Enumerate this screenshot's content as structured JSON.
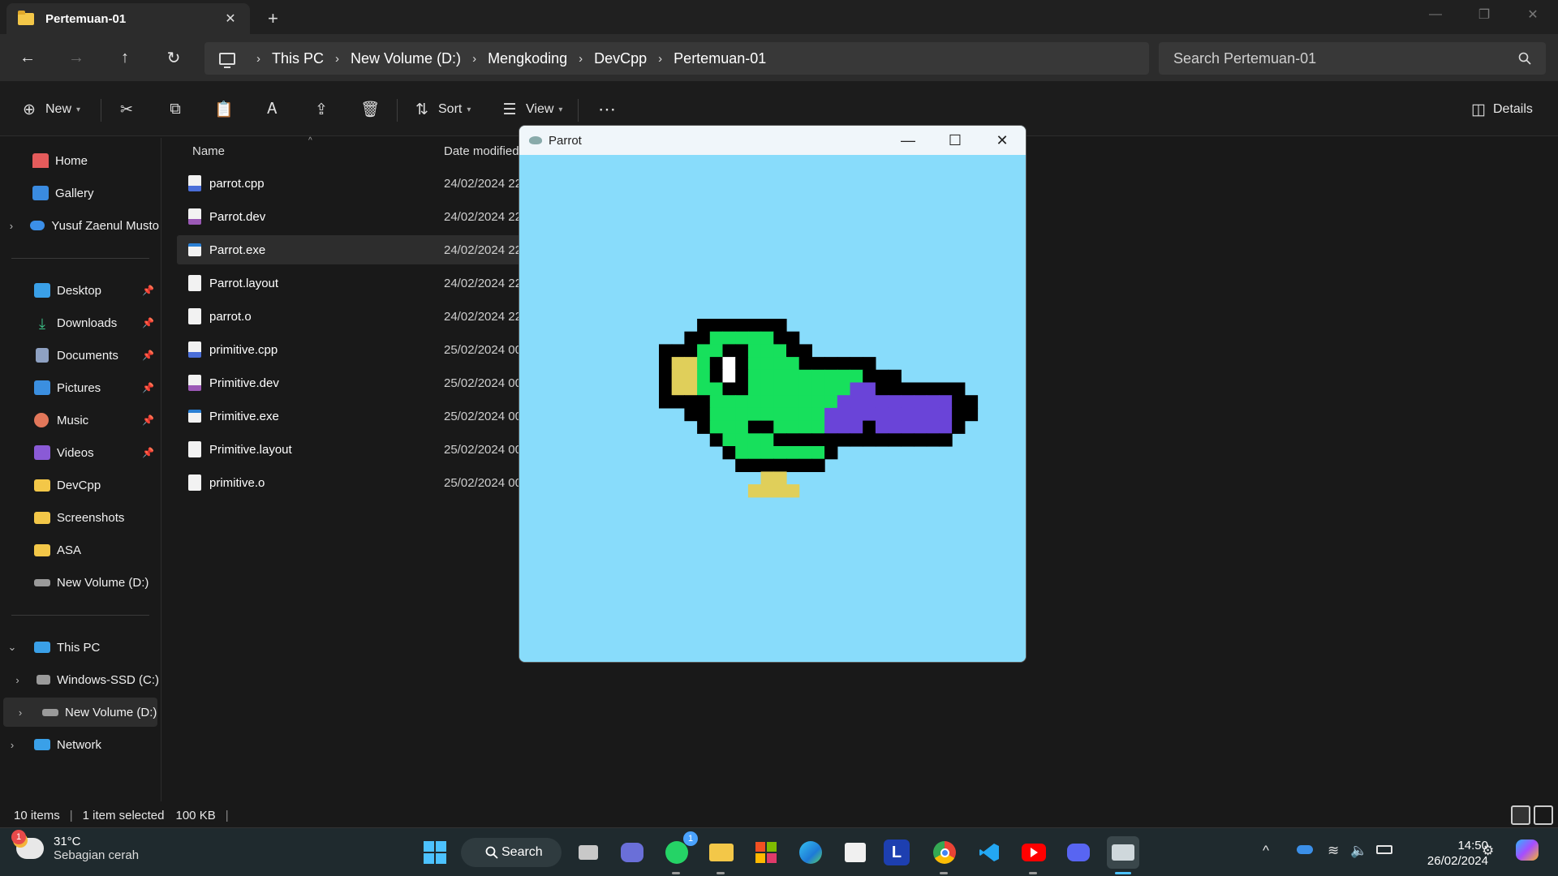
{
  "explorer": {
    "tab_title": "Pertemuan-01",
    "new_tab_glyph": "+",
    "breadcrumb": [
      "This PC",
      "New Volume (D:)",
      "Mengkoding",
      "DevCpp",
      "Pertemuan-01"
    ],
    "search_placeholder": "Search Pertemuan-01",
    "commands": {
      "new": "New",
      "sort": "Sort",
      "view": "View",
      "details": "Details"
    },
    "sidebar": {
      "home": "Home",
      "gallery": "Gallery",
      "onedrive": "Yusuf Zaenul Musto",
      "quick": [
        "Desktop",
        "Downloads",
        "Documents",
        "Pictures",
        "Music",
        "Videos",
        "DevCpp",
        "Screenshots",
        "ASA",
        "New Volume (D:)"
      ],
      "this_pc": "This PC",
      "drives": [
        "Windows-SSD (C:)",
        "New Volume (D:)"
      ],
      "network": "Network"
    },
    "columns": {
      "name": "Name",
      "date": "Date modified"
    },
    "files": [
      {
        "name": "parrot.cpp",
        "date": "24/02/2024 22",
        "type": "cpp"
      },
      {
        "name": "Parrot.dev",
        "date": "24/02/2024 22",
        "type": "dev"
      },
      {
        "name": "Parrot.exe",
        "date": "24/02/2024 22",
        "type": "exe",
        "selected": true
      },
      {
        "name": "Parrot.layout",
        "date": "24/02/2024 22",
        "type": "file"
      },
      {
        "name": "parrot.o",
        "date": "24/02/2024 22",
        "type": "file"
      },
      {
        "name": "primitive.cpp",
        "date": "25/02/2024 00",
        "type": "cpp"
      },
      {
        "name": "Primitive.dev",
        "date": "25/02/2024 00",
        "type": "dev"
      },
      {
        "name": "Primitive.exe",
        "date": "25/02/2024 00",
        "type": "exe"
      },
      {
        "name": "Primitive.layout",
        "date": "25/02/2024 00",
        "type": "file"
      },
      {
        "name": "primitive.o",
        "date": "25/02/2024 00",
        "type": "file"
      }
    ],
    "status": {
      "items": "10 items",
      "selected": "1 item selected",
      "size": "100 KB"
    }
  },
  "parrot_window": {
    "title": "Parrot",
    "background": "#88dcfb",
    "palette": {
      "K": "#000000",
      "G": "#17e05c",
      "Y": "#e0cf5a",
      "W": "#ffffff",
      "P": "#6a44d8"
    },
    "pixels": [
      "...KKKKKKK....................",
      "..KKGGGGGKK...................",
      "KKKGGKKGGGKK..................",
      "KYYGKWKGGGGKKKKKK.............",
      "KYYGKWKGGGGGGGGGKKK...........",
      "KYYGGKKGGGGGGGGPPKKKKKKK......",
      "KKKKGGGGGGGGGGPPPPPPPPPKK.....",
      "..KKGGGGGGGGGPPPPPPPPPPKK.....",
      "...KGGGKKGGGGPPPKPPPPPPK......",
      "....KGGGGKKKKKKKKKKKKKK.......",
      ".....KGGGGGGGK................",
      "......KKKKKKK.................",
      "........YY....................",
      ".......YYYY..................."
    ]
  },
  "taskbar": {
    "weather": {
      "temp": "31°C",
      "desc": "Sebagian cerah",
      "badge": "1"
    },
    "search_label": "Search",
    "whatsapp_badge": "1",
    "l_app_letter": "L",
    "time": "14:50",
    "date": "26/02/2024"
  },
  "colors": {
    "accent": "#4cc2ff",
    "folder": "#f3c748"
  }
}
